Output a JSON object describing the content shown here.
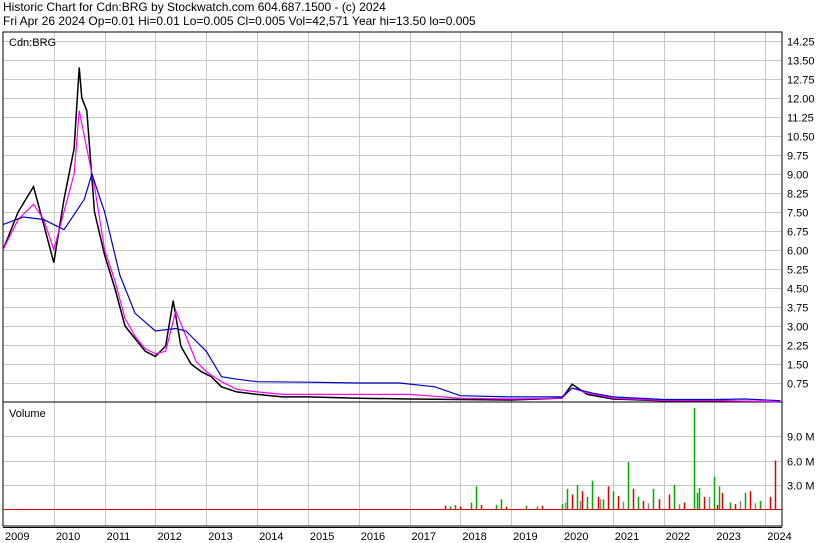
{
  "header": {
    "title_line": "Historic Chart for Cdn:BRG by Stockwatch.com 604.687.1500 - (c) 2024",
    "quote_line": "Fri Apr 26 2024   Op=0.01   Hi=0.01   Lo=0.005   Cl=0.005   Vol=42,571   Year hi=13.50   lo=0.005"
  },
  "chart_data": [
    {
      "type": "line",
      "panel": "price",
      "label": "Cdn:BRG",
      "x_ticks": [
        "2009",
        "2010",
        "2011",
        "2012",
        "2013",
        "2014",
        "2015",
        "2016",
        "2017",
        "2018",
        "2019",
        "2020",
        "2021",
        "2022",
        "2023",
        "2024"
      ],
      "y_ticks": [
        "14.25",
        "13.50",
        "12.75",
        "12.00",
        "11.25",
        "10.50",
        "9.75",
        "9.00",
        "8.25",
        "7.50",
        "6.75",
        "6.00",
        "5.25",
        "4.50",
        "3.75",
        "3.00",
        "2.25",
        "1.50",
        "0.75"
      ],
      "ylim": [
        0,
        14.6
      ],
      "series": [
        {
          "color": "#000000",
          "x": [
            2009.0,
            2009.3,
            2009.6,
            2009.8,
            2010.0,
            2010.2,
            2010.4,
            2010.5,
            2010.55,
            2010.65,
            2010.8,
            2011.0,
            2011.2,
            2011.4,
            2011.6,
            2011.8,
            2012.0,
            2012.2,
            2012.35,
            2012.5,
            2012.7,
            2012.9,
            2013.1,
            2013.3,
            2013.6,
            2014.0,
            2014.5,
            2015.0,
            2016.0,
            2017.0,
            2018.0,
            2019.0,
            2020.0,
            2020.2,
            2020.5,
            2021.0,
            2022.0,
            2023.0,
            2024.3
          ],
          "y": [
            6.0,
            7.5,
            8.5,
            7.0,
            5.5,
            8.0,
            10.0,
            13.2,
            12.0,
            11.5,
            7.5,
            5.8,
            4.5,
            3.0,
            2.5,
            2.0,
            1.8,
            2.2,
            4.0,
            2.2,
            1.5,
            1.2,
            1.0,
            0.6,
            0.4,
            0.3,
            0.2,
            0.2,
            0.15,
            0.12,
            0.1,
            0.08,
            0.15,
            0.7,
            0.3,
            0.12,
            0.05,
            0.05,
            0.005
          ]
        },
        {
          "color": "#ff00ff",
          "x": [
            2009.0,
            2009.3,
            2009.6,
            2009.8,
            2010.0,
            2010.2,
            2010.4,
            2010.5,
            2010.6,
            2010.8,
            2011.0,
            2011.2,
            2011.4,
            2011.6,
            2011.8,
            2012.0,
            2012.2,
            2012.4,
            2012.6,
            2012.8,
            2013.0,
            2013.3,
            2013.6,
            2014.0,
            2014.5,
            2015.0,
            2016.0,
            2017.0,
            2018.0,
            2019.0,
            2020.0,
            2020.2,
            2020.5,
            2021.0,
            2022.0,
            2023.0,
            2024.3
          ],
          "y": [
            6.0,
            7.2,
            7.8,
            7.2,
            6.0,
            7.5,
            9.0,
            11.5,
            10.5,
            8.5,
            6.0,
            4.8,
            3.3,
            2.6,
            2.1,
            1.9,
            2.0,
            3.6,
            2.6,
            1.6,
            1.2,
            0.8,
            0.5,
            0.4,
            0.3,
            0.3,
            0.3,
            0.3,
            0.15,
            0.12,
            0.15,
            0.55,
            0.35,
            0.15,
            0.06,
            0.05,
            0.01
          ]
        },
        {
          "color": "#0000cc",
          "x": [
            2009.0,
            2009.4,
            2009.8,
            2010.2,
            2010.6,
            2010.75,
            2011.0,
            2011.3,
            2011.6,
            2012.0,
            2012.4,
            2012.6,
            2013.0,
            2013.3,
            2013.6,
            2014.0,
            2015.0,
            2016.0,
            2016.8,
            2017.5,
            2018.0,
            2019.0,
            2020.0,
            2020.2,
            2020.6,
            2021.0,
            2022.0,
            2023.0,
            2023.6,
            2024.3
          ],
          "y": [
            7.0,
            7.3,
            7.2,
            6.8,
            8.0,
            9.0,
            7.5,
            5.0,
            3.5,
            2.8,
            2.9,
            2.8,
            2.0,
            1.0,
            0.9,
            0.8,
            0.78,
            0.75,
            0.75,
            0.6,
            0.25,
            0.2,
            0.2,
            0.55,
            0.35,
            0.2,
            0.1,
            0.1,
            0.12,
            0.05
          ]
        }
      ]
    },
    {
      "type": "bar",
      "panel": "volume",
      "title": "Volume",
      "y_ticks": [
        "9.0 M",
        "6.0 M",
        "3.0 M"
      ],
      "ylim": [
        0,
        12.5
      ],
      "series": [
        {
          "color": "#00aa00",
          "x": [
            2017.8,
            2017.9,
            2018.2,
            2018.3,
            2018.7,
            2018.8,
            2019.3,
            2019.5,
            2020.0,
            2020.1,
            2020.3,
            2020.5,
            2020.6,
            2020.8,
            2021.0,
            2021.3,
            2021.5,
            2021.8,
            2022.2,
            2022.6,
            2022.65,
            2022.7,
            2023.0,
            2023.1,
            2023.3,
            2023.6,
            2023.9
          ],
          "values": [
            0.3,
            0.5,
            0.8,
            2.8,
            0.5,
            1.2,
            0.4,
            0.3,
            0.6,
            2.5,
            3.0,
            1.5,
            3.5,
            1.2,
            2.2,
            5.8,
            1.5,
            2.5,
            3.0,
            12.5,
            2.0,
            2.6,
            4.0,
            2.8,
            0.8,
            2.0,
            1.0
          ]
        },
        {
          "color": "#dd0000",
          "x": [
            2017.7,
            2018.0,
            2018.4,
            2018.9,
            2019.6,
            2020.2,
            2020.4,
            2020.7,
            2020.9,
            2021.1,
            2021.4,
            2021.6,
            2021.9,
            2022.1,
            2022.4,
            2022.8,
            2023.05,
            2023.15,
            2023.4,
            2023.7,
            2024.1,
            2024.2
          ],
          "values": [
            0.4,
            0.3,
            0.5,
            0.3,
            0.4,
            1.8,
            2.2,
            1.5,
            2.8,
            1.6,
            2.5,
            1.0,
            1.2,
            1.8,
            0.8,
            1.5,
            0.5,
            2.0,
            0.6,
            2.2,
            1.5,
            6.0
          ]
        },
        {
          "color": "#888888",
          "x": [
            2020.05,
            2020.35,
            2020.75,
            2021.2,
            2021.7,
            2022.3,
            2022.9,
            2023.5,
            2023.8
          ],
          "values": [
            0.8,
            1.0,
            1.2,
            0.9,
            0.7,
            0.6,
            1.5,
            1.0,
            0.7
          ]
        }
      ]
    }
  ]
}
